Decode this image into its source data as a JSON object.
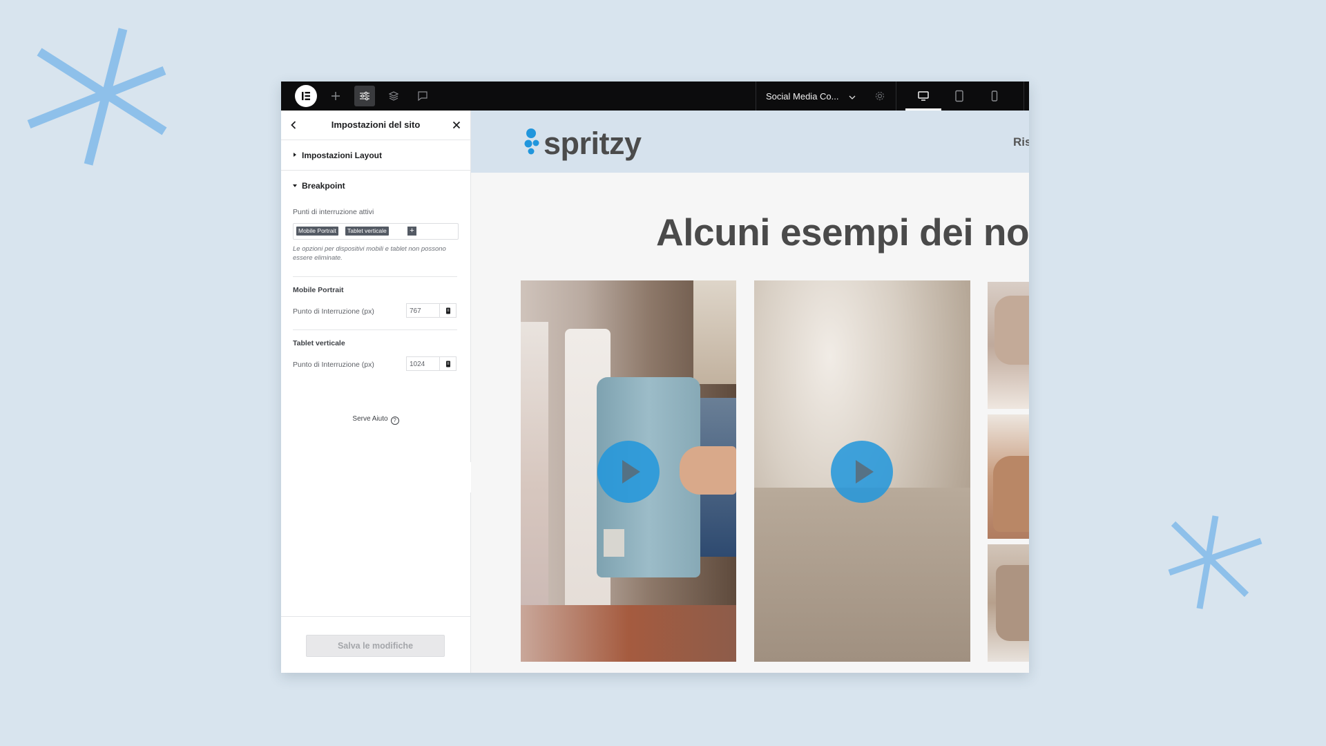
{
  "topbar": {
    "site_selector": "Social Media Co...",
    "icons": [
      "elementor-logo-icon",
      "plus-icon",
      "sliders-icon",
      "layers-icon",
      "comment-icon",
      "gear-icon",
      "desktop-icon",
      "tablet-icon",
      "mobile-icon"
    ]
  },
  "panel": {
    "title": "Impostazioni del sito",
    "sections": {
      "layout": "Impostazioni Layout",
      "breakpoint": "Breakpoint"
    },
    "active_label": "Punti di interruzione attivi",
    "chips": [
      "Mobile Portrait",
      "Tablet verticale"
    ],
    "chip_add": "+",
    "note": "Le opzioni per dispositivi mobili e tablet non possono essere eliminate.",
    "groups": [
      {
        "title": "Mobile Portrait",
        "field_label": "Punto di Interruzione (px)",
        "value": "767"
      },
      {
        "title": "Tablet verticale",
        "field_label": "Punto di Interruzione (px)",
        "value": "1024"
      }
    ],
    "help": "Serve Aiuto",
    "save_button": "Salva le modifiche"
  },
  "preview": {
    "brand": "spritzy",
    "nav_item": "Ris",
    "headline": "Alcuni esempi dei no"
  },
  "colors": {
    "background": "#d8e4ee",
    "topbar": "#0c0c0d",
    "accent_blue": "#2196dc",
    "asterisk": "#8ec0ea"
  }
}
